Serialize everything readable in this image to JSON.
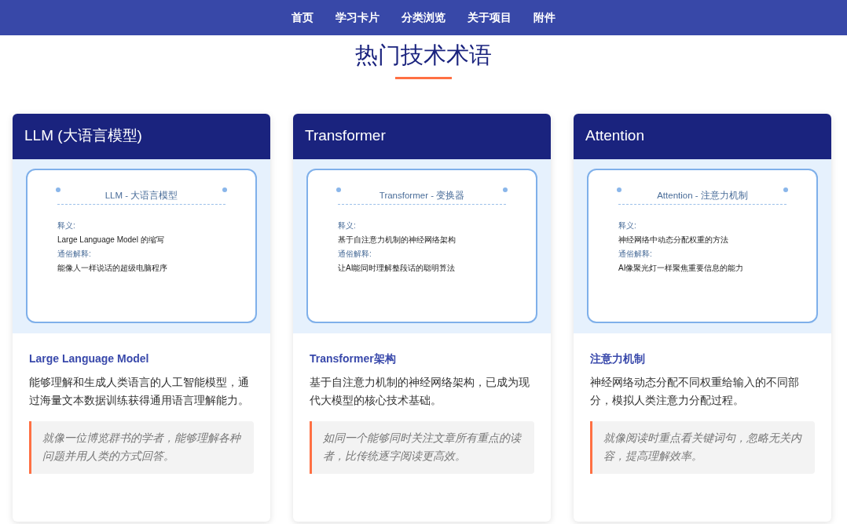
{
  "nav": [
    {
      "label": "首页"
    },
    {
      "label": "学习卡片"
    },
    {
      "label": "分类浏览"
    },
    {
      "label": "关于项目"
    },
    {
      "label": "附件"
    }
  ],
  "section_title": "热门技术术语",
  "cards": [
    {
      "title": "LLM (大语言模型)",
      "figure": {
        "heading": "LLM - 大语言模型",
        "definition_label": "释义:",
        "definition": "Large Language Model 的缩写",
        "plain_label": "通俗解释:",
        "plain": "能像人一样说话的超级电脑程序"
      },
      "subtitle": "Large Language Model",
      "description": "能够理解和生成人类语言的人工智能模型，通过海量文本数据训练获得通用语言理解能力。",
      "analogy": "就像一位博览群书的学者，能够理解各种问题并用人类的方式回答。"
    },
    {
      "title": "Transformer",
      "figure": {
        "heading": "Transformer - 变换器",
        "definition_label": "释义:",
        "definition": "基于自注意力机制的神经网络架构",
        "plain_label": "通俗解释:",
        "plain": "让AI能同时理解整段话的聪明算法"
      },
      "subtitle": "Transformer架构",
      "description": "基于自注意力机制的神经网络架构，已成为现代大模型的核心技术基础。",
      "analogy": "如同一个能够同时关注文章所有重点的读者，比传统逐字阅读更高效。"
    },
    {
      "title": "Attention",
      "figure": {
        "heading": "Attention - 注意力机制",
        "definition_label": "释义:",
        "definition": "神经网络中动态分配权重的方法",
        "plain_label": "通俗解释:",
        "plain": "AI像聚光灯一样聚焦重要信息的能力"
      },
      "subtitle": "注意力机制",
      "description": "神经网络动态分配不同权重给输入的不同部分，模拟人类注意力分配过程。",
      "analogy": "就像阅读时重点看关键词句，忽略无关内容，提高理解效率。"
    }
  ]
}
